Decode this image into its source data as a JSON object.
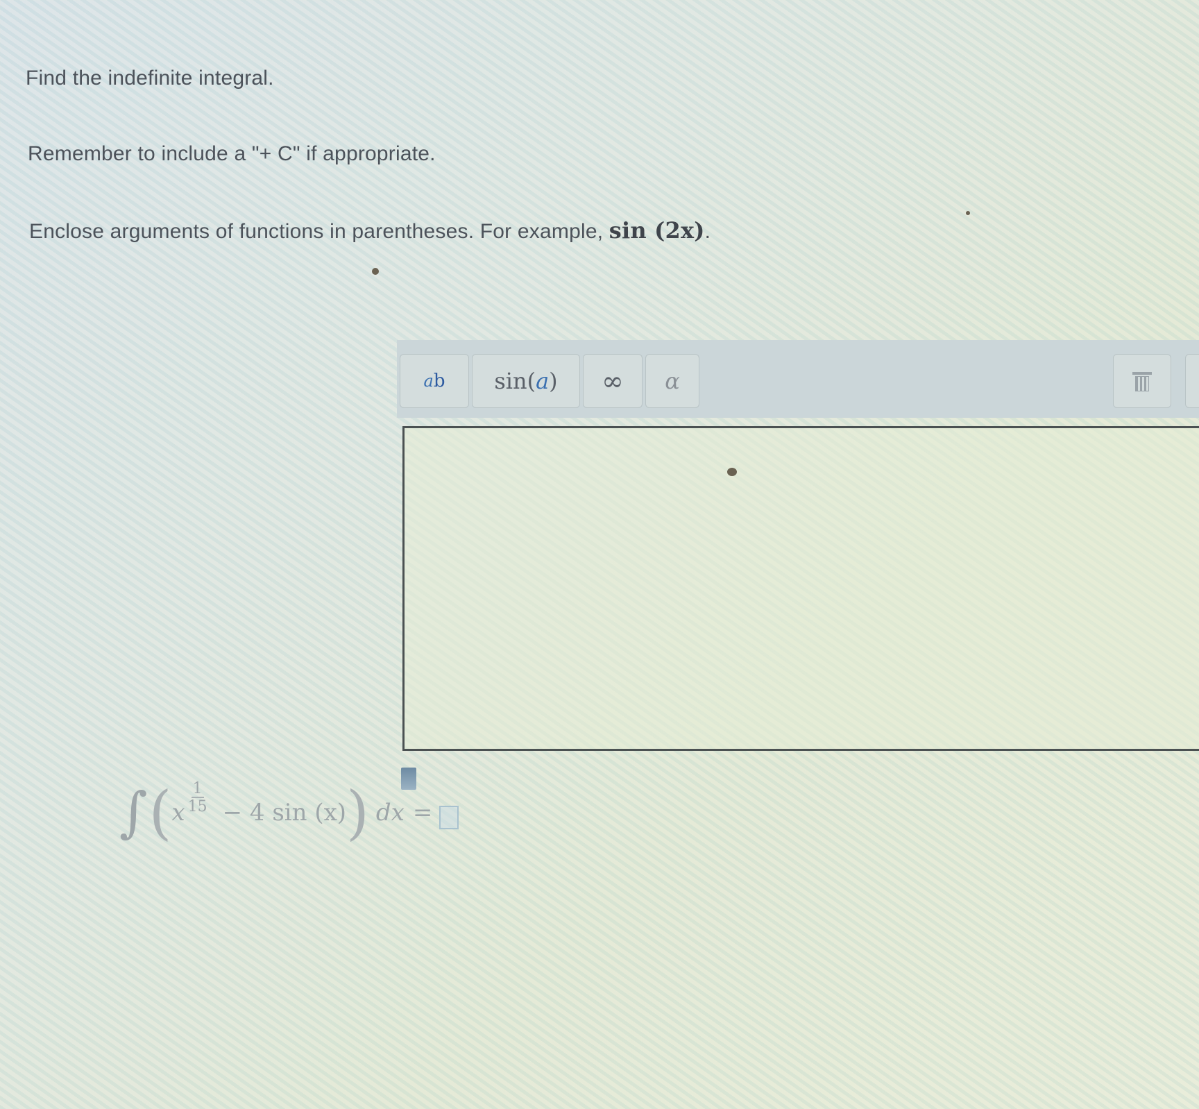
{
  "instructions": {
    "line1": "Find the indefinite integral.",
    "line2": "Remember to include a \"+ C\" if appropriate.",
    "line3_prefix": "Enclose arguments of functions in parentheses. For example,",
    "line3_example": "sin (2x)",
    "line3_suffix": "."
  },
  "toolbar": {
    "power_base": "a",
    "power_exp": "b",
    "sin_fn": "sin",
    "sin_open": " (",
    "sin_arg": "a",
    "sin_close": ")",
    "infinity": "∞",
    "alpha": "α",
    "icons": [
      "trash-icon"
    ]
  },
  "answer": {
    "value": ""
  },
  "problem": {
    "integral_sign": "∫",
    "open_paren": "(",
    "variable": "x",
    "exponent_num": "1",
    "exponent_den": "15",
    "minus_term": "− 4 sin (x)",
    "close_paren": ")",
    "dx": "dx",
    "equals": "="
  },
  "colors": {
    "toolbar_bg": "#cbd6d9",
    "answer_border": "#4b5152",
    "accent_blue": "#3a6fb0"
  }
}
